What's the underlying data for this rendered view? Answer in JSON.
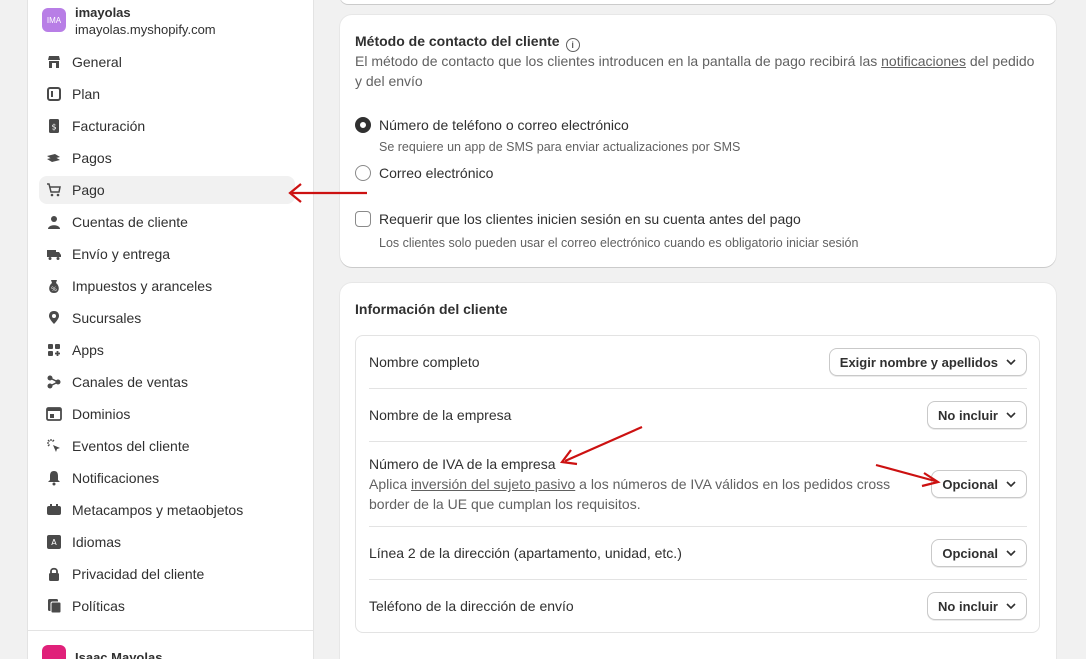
{
  "store": {
    "avatar": "IMA",
    "name": "imayolas",
    "url": "imayolas.myshopify.com"
  },
  "nav": [
    {
      "label": "General",
      "icon": "store-icon"
    },
    {
      "label": "Plan",
      "icon": "plan-icon"
    },
    {
      "label": "Facturación",
      "icon": "billing-icon"
    },
    {
      "label": "Pagos",
      "icon": "payments-icon"
    },
    {
      "label": "Pago",
      "icon": "cart-icon",
      "active": true
    },
    {
      "label": "Cuentas de cliente",
      "icon": "person-icon"
    },
    {
      "label": "Envío y entrega",
      "icon": "truck-icon"
    },
    {
      "label": "Impuestos y aranceles",
      "icon": "tax-icon"
    },
    {
      "label": "Sucursales",
      "icon": "location-icon"
    },
    {
      "label": "Apps",
      "icon": "apps-icon"
    },
    {
      "label": "Canales de ventas",
      "icon": "channels-icon"
    },
    {
      "label": "Dominios",
      "icon": "domains-icon"
    },
    {
      "label": "Eventos del cliente",
      "icon": "cursor-icon"
    },
    {
      "label": "Notificaciones",
      "icon": "bell-icon"
    },
    {
      "label": "Metacampos y metaobjetos",
      "icon": "metafields-icon"
    },
    {
      "label": "Idiomas",
      "icon": "language-icon"
    },
    {
      "label": "Privacidad del cliente",
      "icon": "lock-icon"
    },
    {
      "label": "Políticas",
      "icon": "policies-icon"
    }
  ],
  "user": {
    "name": "Isaac Mayolas"
  },
  "contact": {
    "title": "Método de contacto del cliente",
    "desc_before": "El método de contacto que los clientes introducen en la pantalla de pago recibirá las ",
    "desc_link": "notificaciones",
    "desc_after": " del pedido",
    "desc_line2": "y del envío",
    "option1": "Número de teléfono o correo electrónico",
    "option1_help": "Se requiere un app de SMS para enviar actualizaciones por SMS",
    "option2": "Correo electrónico",
    "require_login": "Requerir que los clientes inicien sesión en su cuenta antes del pago",
    "require_login_help": "Los clientes solo pueden usar el correo electrónico cuando es obligatorio iniciar sesión"
  },
  "info": {
    "title": "Información del cliente",
    "fields": [
      {
        "label": "Nombre completo",
        "value": "Exigir nombre y apellidos"
      },
      {
        "label": "Nombre de la empresa",
        "value": "No incluir"
      },
      {
        "label": "Número de IVA de la empresa",
        "value": "Opcional"
      },
      {
        "label": "Línea 2 de la dirección (apartamento, unidad, etc.)",
        "value": "Opcional"
      },
      {
        "label": "Teléfono de la dirección de envío",
        "value": "No incluir"
      }
    ],
    "vat_desc_before": "Aplica ",
    "vat_desc_link": "inversión del sujeto pasivo",
    "vat_desc_after": " a los números de IVA válidos en los pedidos cross",
    "vat_desc_line2": "border de la UE que cumplan los requisitos."
  },
  "colors": {
    "annotation_arrow": "#cc1111",
    "active_nav_bg": "#f1f1f1"
  }
}
